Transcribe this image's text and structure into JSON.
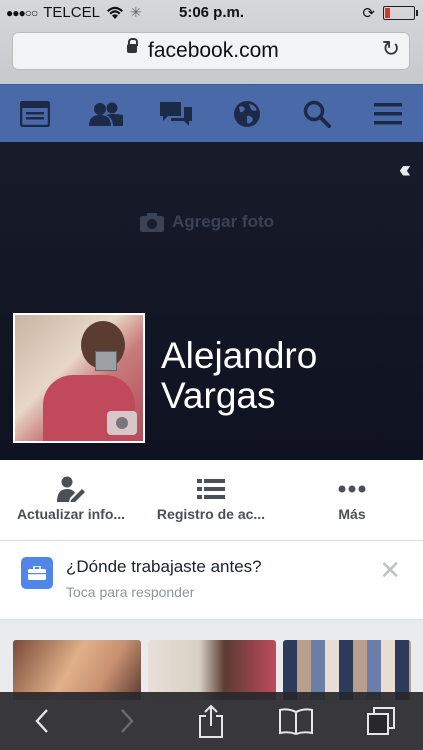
{
  "status_bar": {
    "carrier": "TELCEL",
    "time": "5:06 p.m."
  },
  "browser": {
    "url": "facebook.com"
  },
  "fb_nav": {
    "items": [
      "news-feed",
      "friends",
      "messages",
      "notifications",
      "search",
      "menu"
    ]
  },
  "cover": {
    "add_photo_label": "Agregar foto"
  },
  "profile": {
    "name": "Alejandro Vargas"
  },
  "actions": [
    {
      "label": "Actualizar info...",
      "icon": "edit-profile-icon"
    },
    {
      "label": "Registro de ac...",
      "icon": "activity-log-icon"
    },
    {
      "label": "Más",
      "icon": "more-icon"
    }
  ],
  "question": {
    "title": "¿Dónde trabajaste antes?",
    "subtitle": "Toca para responder"
  },
  "colors": {
    "fb_blue": "#4a69a8",
    "question_icon": "#4f86e8"
  }
}
